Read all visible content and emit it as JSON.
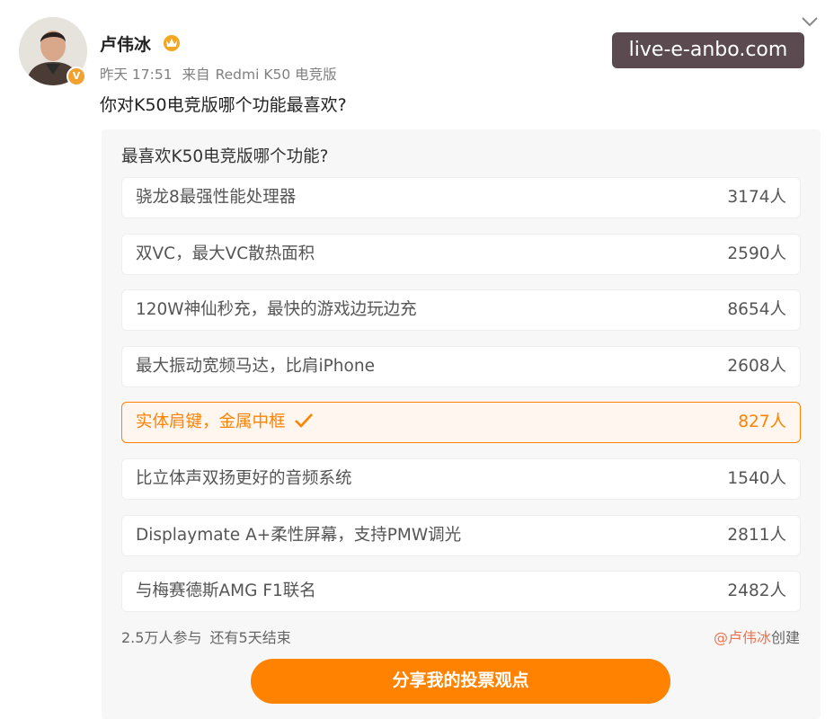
{
  "post": {
    "username": "卢伟冰",
    "time": "昨天 17:51",
    "source_prefix": "来自",
    "source": "Redmi K50 电竞版",
    "text": "你对K50电竞版哪个功能最喜欢?",
    "verified_badge": "V"
  },
  "watermark": "live-e-anbo.com",
  "poll": {
    "question": "最喜欢K50电竞版哪个功能?",
    "options": [
      {
        "label": "骁龙8最强性能处理器",
        "count": "3174人",
        "selected": false
      },
      {
        "label": "双VC，最大VC散热面积",
        "count": "2590人",
        "selected": false
      },
      {
        "label": "120W神仙秒充，最快的游戏边玩边充",
        "count": "8654人",
        "selected": false
      },
      {
        "label": "最大振动宽频马达，比肩iPhone",
        "count": "2608人",
        "selected": false
      },
      {
        "label": "实体肩键，金属中框",
        "count": "827人",
        "selected": true
      },
      {
        "label": "比立体声双扬更好的音频系统",
        "count": "1540人",
        "selected": false
      },
      {
        "label": "Displaymate A+柔性屏幕，支持PMW调光",
        "count": "2811人",
        "selected": false
      },
      {
        "label": "与梅赛德斯AMG F1联名",
        "count": "2482人",
        "selected": false
      }
    ],
    "participants": "2.5万人参与",
    "remaining": "还有5天结束",
    "creator": "@卢伟冰",
    "created_suffix": "创建",
    "share_label": "分享我的投票观点"
  },
  "icons": {
    "avatar": "avatar-photo",
    "crown": "crown-icon",
    "chevron": "chevron-down-icon",
    "check": "check-icon"
  },
  "colors": {
    "accent": "#ff8200",
    "verified": "#f2a12e",
    "creator_link": "#eb7350"
  }
}
